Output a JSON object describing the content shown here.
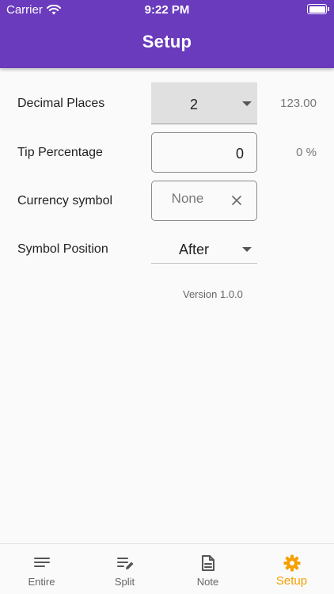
{
  "status_bar": {
    "carrier": "Carrier",
    "time": "9:22 PM"
  },
  "header": {
    "title": "Setup"
  },
  "settings": {
    "decimal_places": {
      "label": "Decimal Places",
      "value": "2",
      "preview": "123.00"
    },
    "tip_percentage": {
      "label": "Tip Percentage",
      "value": "0",
      "preview": "0 %"
    },
    "currency_symbol": {
      "label": "Currency symbol",
      "value": "None"
    },
    "symbol_position": {
      "label": "Symbol Position",
      "value": "After"
    }
  },
  "version": "Version 1.0.0",
  "tabs": [
    {
      "label": "Entire",
      "icon": "lines-icon"
    },
    {
      "label": "Split",
      "icon": "edit-list-icon"
    },
    {
      "label": "Note",
      "icon": "note-icon"
    },
    {
      "label": "Setup",
      "icon": "gear-icon"
    }
  ],
  "colors": {
    "header": "#6a3bbd",
    "active_tab": "#f5a000"
  }
}
